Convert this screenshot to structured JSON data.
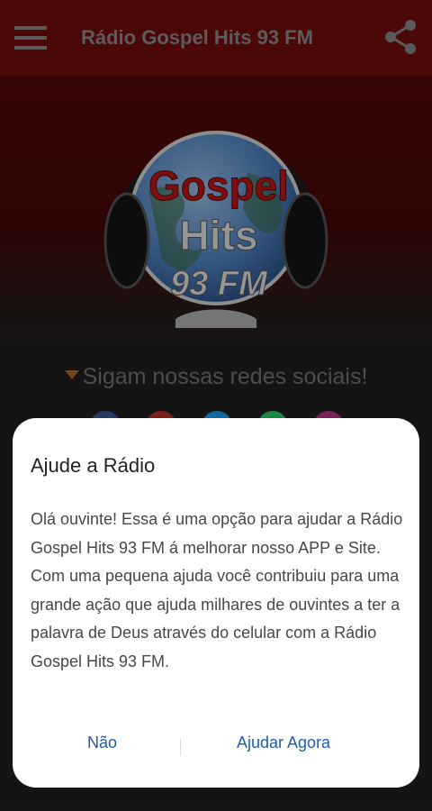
{
  "app": {
    "title": "Rádio Gospel Hits 93 FM",
    "menu_icon": "hamburger-menu-icon",
    "share_icon": "share-icon"
  },
  "logo": {
    "line1": "Gospel",
    "line2": "Hits",
    "line3": "93 FM"
  },
  "social": {
    "heading": "Sigam nossas redes sociais!",
    "icons": [
      "facebook-icon",
      "youtube-icon",
      "twitter-icon",
      "whatsapp-icon",
      "instagram-icon"
    ],
    "colors": [
      "#3b5998",
      "#c4302b",
      "#1da1f2",
      "#25d366",
      "#c13584"
    ]
  },
  "dialog": {
    "title": "Ajude a Rádio",
    "message": "Olá ouvinte! Essa é uma opção para ajudar a Rádio Gospel Hits 93 FM á melhorar nosso APP e Site. Com uma pequena ajuda você contribuiu para uma grande ação que ajuda milhares de ouvintes a ter a palavra de Deus através do celular com a Rádio Gospel Hits 93 FM.",
    "negative_label": "Não",
    "positive_label": "Ajudar Agora"
  },
  "colors": {
    "toolbar": "#730d0d",
    "accent": "#1d5fa7"
  }
}
